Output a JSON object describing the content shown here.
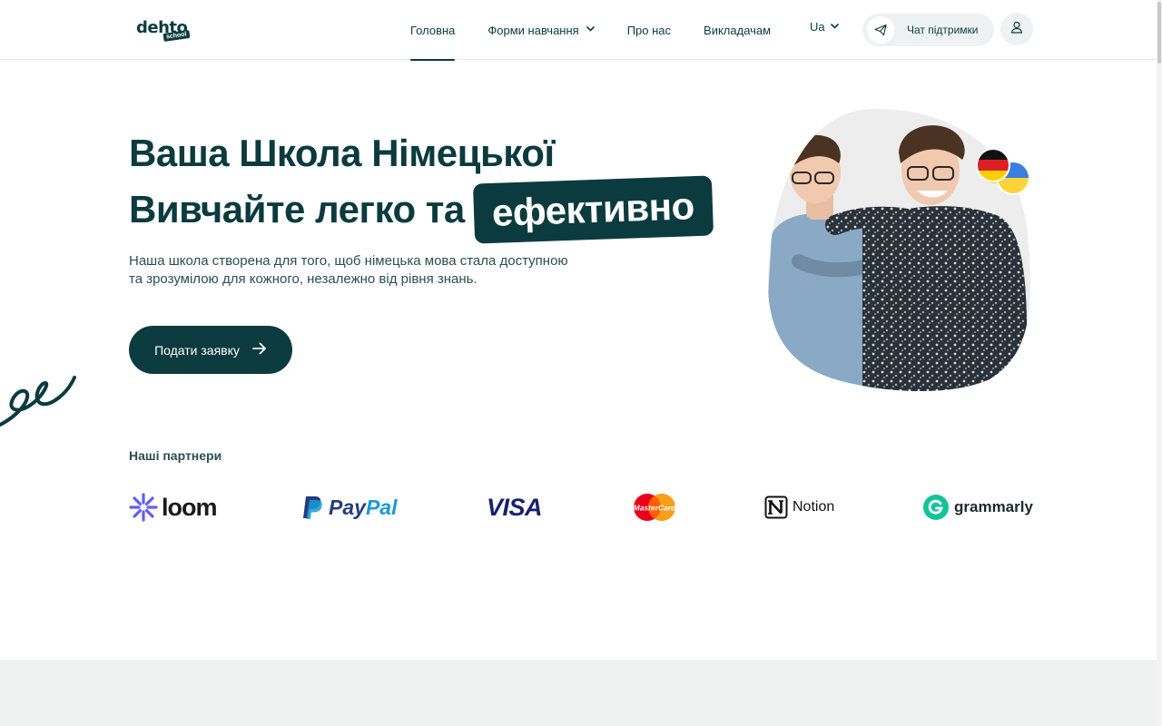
{
  "header": {
    "logo": {
      "main": "dehto",
      "sub": "school"
    },
    "nav": [
      {
        "label": "Головна",
        "active": true
      },
      {
        "label": "Форми навчання",
        "dropdown": true
      },
      {
        "label": "Про нас"
      },
      {
        "label": "Викладачам"
      }
    ],
    "language": "Ua",
    "support_label": "Чат підтримки",
    "icons": {
      "support": "telegram-plane-icon",
      "user": "user-icon",
      "chevron": "chevron-down-icon"
    }
  },
  "hero": {
    "title_line1": "Ваша Школа Німецької",
    "title_line2": "Вивчайте легко та",
    "title_highlight": "ефективно",
    "description": "Наша школа створена для того, щоб німецька мова стала доступною та зрозумілою для кожного, незалежно від рівня знань.",
    "cta_label": "Подати заявку"
  },
  "partners": {
    "title": "Наші партнери",
    "items": [
      {
        "name": "loom"
      },
      {
        "name_a": "Pay",
        "name_b": "Pal"
      },
      {
        "name": "VISA"
      },
      {
        "name": "MasterCard"
      },
      {
        "name": "Notion"
      },
      {
        "name": "grammarly"
      }
    ]
  },
  "colors": {
    "brand": "#0b3b3f",
    "band": "#eff2f1",
    "paypal_dark": "#253b80",
    "paypal_light": "#179bd7",
    "visa": "#1a1f71",
    "grammarly": "#15c39a",
    "loom": "#625df5"
  }
}
